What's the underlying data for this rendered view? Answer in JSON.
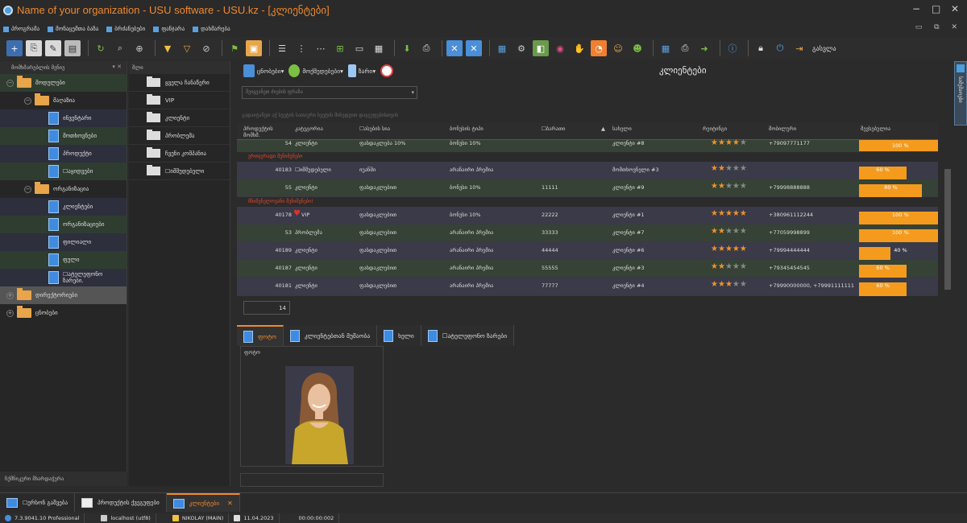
{
  "window": {
    "title": "Name of your organization - USU software - USU.kz - [კლიენტები]",
    "controls": [
      "−",
      "□",
      "✕"
    ]
  },
  "menu": {
    "items": [
      "პროგრამა",
      "მონაცემთა ბაზა",
      "ბრძანებები",
      "ფანჯარა",
      "დახმარება"
    ],
    "window_buttons": "▭ ⧉ ✕"
  },
  "toolbar": {
    "exit_label": "გასვლა"
  },
  "left_panel": {
    "header": "მომხმარებლის მენიუ",
    "items": [
      {
        "label": "მოდულები",
        "type": "folder",
        "level": 0
      },
      {
        "label": "მაღაზია",
        "type": "folder",
        "level": 1
      },
      {
        "label": "ინვენტარი",
        "type": "doc",
        "level": 2
      },
      {
        "label": "მოთხოვნები",
        "type": "doc",
        "level": 2
      },
      {
        "label": "პროდუქტი",
        "type": "doc",
        "level": 2
      },
      {
        "label": "☐აყიდვები",
        "type": "doc",
        "level": 2
      },
      {
        "label": "ორგანიზაცია",
        "type": "folder",
        "level": 1
      },
      {
        "label": "კლიენტები",
        "type": "doc",
        "level": 2
      },
      {
        "label": "ორგანიზაციები",
        "type": "doc",
        "level": 2
      },
      {
        "label": "ფილიალი",
        "type": "doc",
        "level": 2
      },
      {
        "label": "ფული",
        "type": "doc",
        "level": 2
      },
      {
        "label": "☐ატელეფონო ზარები.",
        "type": "doc",
        "level": 2
      },
      {
        "label": "დირექტორიები",
        "type": "folder",
        "level": 0
      },
      {
        "label": "ცნობები",
        "type": "folder",
        "level": 0
      }
    ],
    "bottom": "ჩქმნიკური მხარდაჭერა"
  },
  "mid_panel": {
    "header": "შლი",
    "items": [
      "ყველა ჩანაწერი",
      "VIP",
      "კლიენტი",
      "პრობლემა",
      "ჩვენი კომპანია",
      "☐იმშუდებელი"
    ]
  },
  "main_toolbar": {
    "reports": "ცნობები",
    "actions": "მოქმედებები",
    "calls": "ზარი",
    "title": "კლიენტები"
  },
  "filter": {
    "placeholder": "შეიყვანეთ ძიების ფრაზა",
    "group_hint": "გადაიტანეთ აქ სვეტის სათაური სვეტის მიხედვით დაჯგუფებისთვის"
  },
  "grid": {
    "headers": [
      "პროდუქტის მომხმ.",
      "კატეგორია",
      "☐ასების სია",
      "ბონუსის ტიპი",
      "☐ბარათი",
      "სახელი",
      "რეიტინგი",
      "მობილური",
      "შევსებულია"
    ],
    "rows": [
      {
        "kind": "data",
        "style": "green",
        "id": "54",
        "category": "კლიენტი",
        "pricelist": "ფასდაკლება 10%",
        "bonus": "ბონუსი 10%",
        "card": "",
        "name": "კლიენტი #8",
        "rating": 4,
        "mobile": "+79097771177",
        "fill": 100,
        "fill_label": "100 %"
      },
      {
        "kind": "group",
        "label": "ერთჯერადი შენიშვნები"
      },
      {
        "kind": "data",
        "style": "purple",
        "id": "40183",
        "category": "☐იმშუდებელი",
        "pricelist": "იუანში",
        "bonus": "არანაირი პრემია",
        "card": "",
        "name": "მომთხოვნელი #3",
        "rating": 2,
        "mobile": "",
        "fill": 60,
        "fill_label": "60 %"
      },
      {
        "kind": "data",
        "style": "green",
        "id": "55",
        "category": "კლიენტი",
        "pricelist": "ფასდაკლებით",
        "bonus": "ბონუსი 10%",
        "card": "11111",
        "name": "კლიენტი #9",
        "rating": 2,
        "mobile": "+79998888888",
        "fill": 80,
        "fill_label": "80 %"
      },
      {
        "kind": "group",
        "label": "მნიშვნელოვანი შენიშვნები!"
      },
      {
        "kind": "data",
        "style": "purple",
        "id": "40178",
        "category": "VIP",
        "heart": true,
        "pricelist": "ფასდაკლებით",
        "bonus": "ბონუსი 10%",
        "card": "22222",
        "name": "კლიენტი #1",
        "rating": 5,
        "mobile": "+380961112244",
        "fill": 100,
        "fill_label": "100 %"
      },
      {
        "kind": "data",
        "style": "green",
        "id": "53",
        "category": "პრობლემა",
        "pricelist": "ფასდაკლებით",
        "bonus": "არანაირი პრემია",
        "card": "33333",
        "name": "კლიენტი #7",
        "rating": 2,
        "mobile": "+77059998899",
        "fill": 100,
        "fill_label": "100 %"
      },
      {
        "kind": "data",
        "style": "purple",
        "id": "40189",
        "category": "კლიენტი",
        "pricelist": "ფასდაკლებით",
        "bonus": "არანაირი პრემია",
        "card": "44444",
        "name": "კლიენტი #6",
        "rating": 5,
        "mobile": "+79994444444",
        "fill": 40,
        "fill_label": "40 %"
      },
      {
        "kind": "data",
        "style": "green",
        "id": "40187",
        "category": "კლიენტი",
        "pricelist": "ფასდაკლებით",
        "bonus": "არანაირი პრემია",
        "card": "55555",
        "name": "კლიენტი #3",
        "rating": 2,
        "mobile": "+79345454545",
        "fill": 60,
        "fill_label": "60 %"
      },
      {
        "kind": "data",
        "style": "purple",
        "id": "40181",
        "category": "კლიენტი",
        "pricelist": "ფასდაკლებით",
        "bonus": "არანაირი პრემია",
        "card": "77777",
        "name": "კლიენტი #4",
        "rating": 3,
        "mobile": "+79990000000, +79991111111",
        "fill": 60,
        "fill_label": "60 %"
      }
    ],
    "footer_count": "14"
  },
  "detail_tabs": [
    "ფოტო",
    "კლიენტებთან მუშაობა",
    "ხელი",
    "☐ატელეფონო ზარები"
  ],
  "photo_panel": {
    "label": "ფოტო"
  },
  "taskbar": {
    "items": [
      {
        "label": "☐ერსონ გაშვება",
        "active": false
      },
      {
        "label": "პროდუქტის ქვეგუფები",
        "active": false
      },
      {
        "label": "კლიენტები",
        "active": true
      }
    ]
  },
  "statusbar": {
    "version": "7.3.9041.10 Professional",
    "db": "localhost (utf8)",
    "user": "NIKOLAY (MAIN)",
    "date": "11.04.2023",
    "timer": "00:00:00:002"
  },
  "right_strip": {
    "label": "სამუშაოები"
  },
  "colors": {
    "accent": "#f0892c",
    "bar": "#f49b1e",
    "green_row": "#354235",
    "purple_row": "#3a3a48",
    "doc_blue": "#3f8be0"
  }
}
